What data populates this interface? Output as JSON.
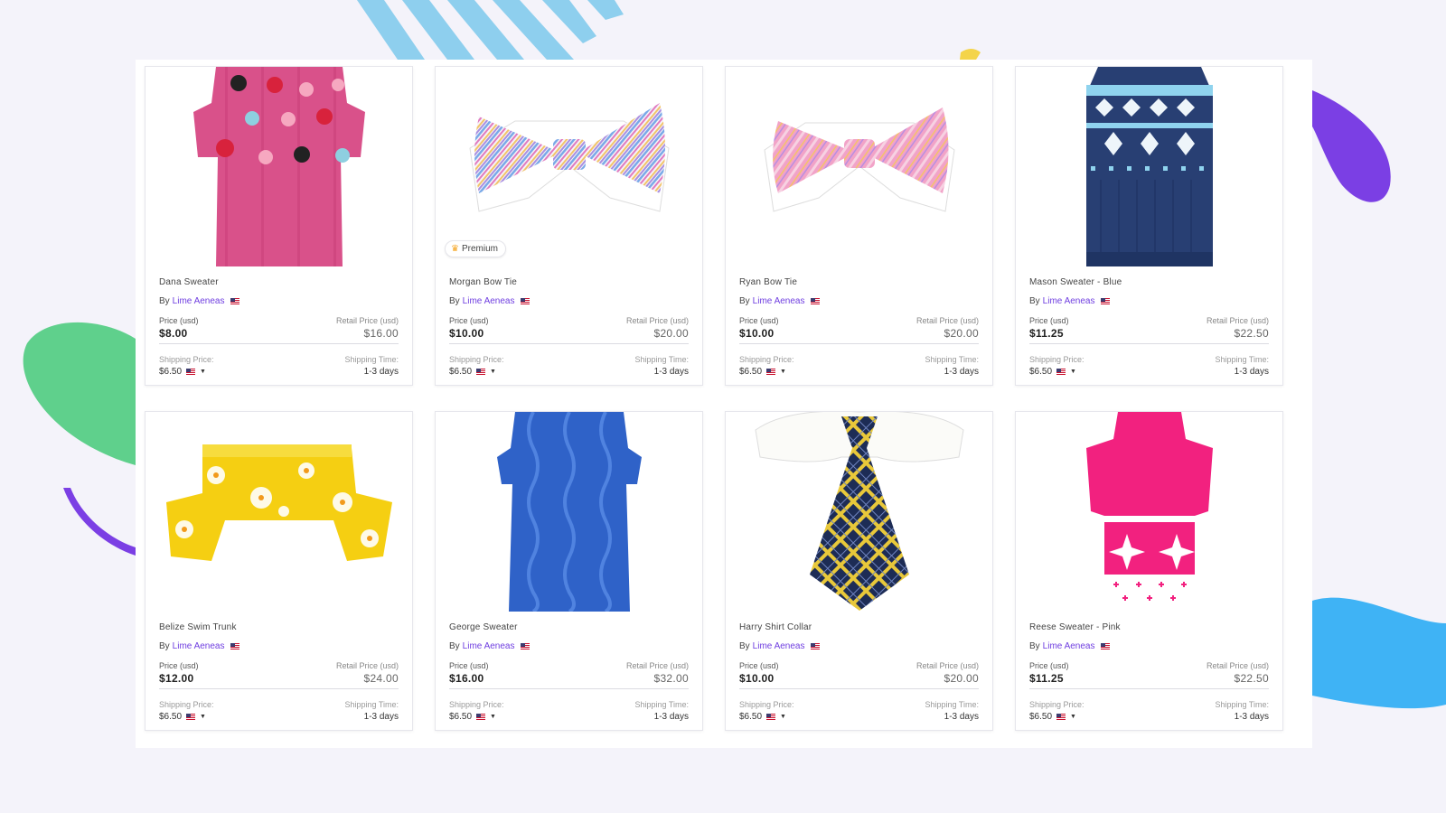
{
  "labels": {
    "by": "By",
    "price": "Price (usd)",
    "retail": "Retail Price (usd)",
    "shipping_price": "Shipping Price:",
    "shipping_time": "Shipping Time:",
    "premium": "Premium"
  },
  "colors": {
    "accent": "#6f3ee0",
    "background": "#f4f3fa",
    "decor_green": "#5fd08c",
    "decor_purple": "#7b3fe4",
    "decor_blue": "#3fb3f5",
    "decor_lightblue": "#8ecfee"
  },
  "products": [
    {
      "name": "Dana Sweater",
      "vendor": "Lime Aeneas",
      "price": "$8.00",
      "retail": "$16.00",
      "shipping": "$6.50",
      "time": "1-3 days",
      "image": "pink-pompom-sweater",
      "premium": false
    },
    {
      "name": "Morgan Bow Tie",
      "vendor": "Lime Aeneas",
      "price": "$10.00",
      "retail": "$20.00",
      "shipping": "$6.50",
      "time": "1-3 days",
      "image": "pastel-stripe-bow-tie",
      "premium": true
    },
    {
      "name": "Ryan Bow Tie",
      "vendor": "Lime Aeneas",
      "price": "$10.00",
      "retail": "$20.00",
      "shipping": "$6.50",
      "time": "1-3 days",
      "image": "pink-stripe-bow-tie",
      "premium": false
    },
    {
      "name": "Mason Sweater - Blue",
      "vendor": "Lime Aeneas",
      "price": "$11.25",
      "retail": "$22.50",
      "shipping": "$6.50",
      "time": "1-3 days",
      "image": "navy-fair-isle-sweater",
      "premium": false
    },
    {
      "name": "Belize Swim Trunk",
      "vendor": "Lime Aeneas",
      "price": "$12.00",
      "retail": "$24.00",
      "shipping": "$6.50",
      "time": "1-3 days",
      "image": "yellow-hibiscus-trunk",
      "premium": false
    },
    {
      "name": "George Sweater",
      "vendor": "Lime Aeneas",
      "price": "$16.00",
      "retail": "$32.00",
      "shipping": "$6.50",
      "time": "1-3 days",
      "image": "blue-cable-knit-sweater",
      "premium": false
    },
    {
      "name": "Harry Shirt Collar",
      "vendor": "Lime Aeneas",
      "price": "$10.00",
      "retail": "$20.00",
      "shipping": "$6.50",
      "time": "1-3 days",
      "image": "plaid-tie-collar",
      "premium": false
    },
    {
      "name": "Reese Sweater - Pink",
      "vendor": "Lime Aeneas",
      "price": "$11.25",
      "retail": "$22.50",
      "shipping": "$6.50",
      "time": "1-3 days",
      "image": "pink-snowflake-sweater",
      "premium": false
    }
  ]
}
